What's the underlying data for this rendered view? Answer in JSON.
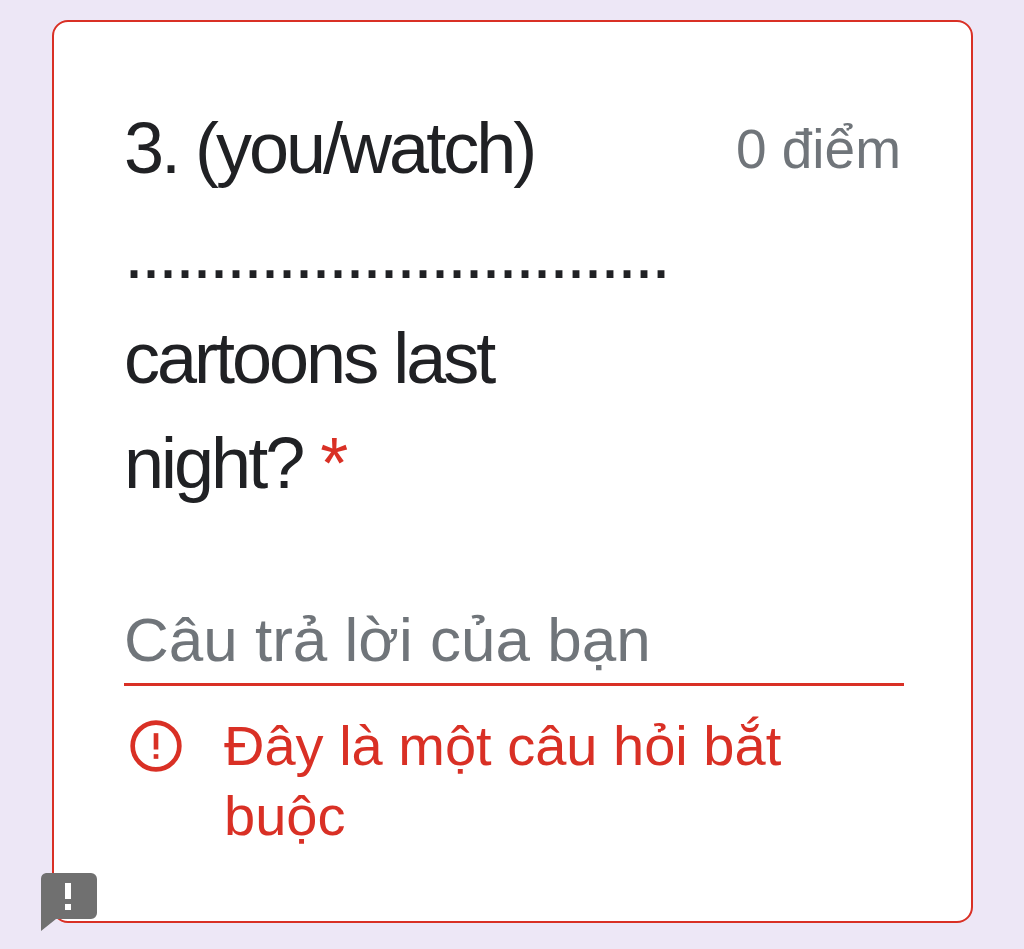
{
  "question": {
    "text": "3. (you/watch) ................................ cartoons last night?",
    "required": true,
    "required_mark": "*",
    "points": "0 điểm"
  },
  "answer": {
    "placeholder": "Câu trả lời của bạn",
    "error": true
  },
  "error_message": "Đây là một câu hỏi bắt buộc"
}
